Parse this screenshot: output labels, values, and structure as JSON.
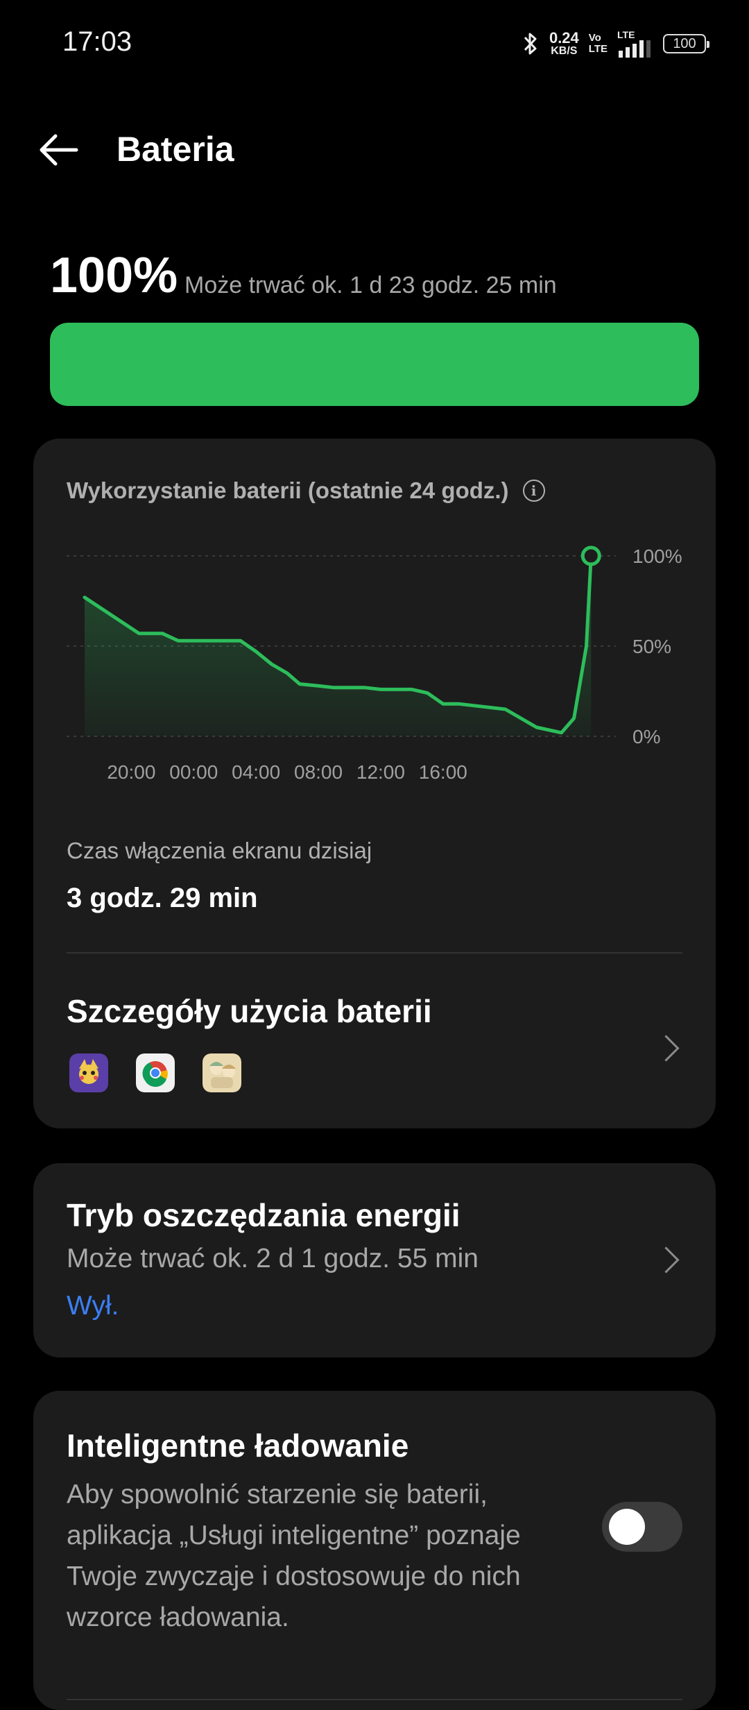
{
  "status_bar": {
    "time": "17:03",
    "net_speed_value": "0.24",
    "net_speed_unit": "KB/S",
    "volte_top": "Vo",
    "volte_bottom": "LTE",
    "signal_label": "LTE",
    "battery_level": "100",
    "icons": [
      "bluetooth-icon",
      "signal-icon",
      "battery-icon"
    ]
  },
  "header": {
    "title": "Bateria",
    "back_icon": "arrow-left-icon"
  },
  "summary": {
    "percent": "100%",
    "estimate": "Może trwać ok. 1 d 23 godz. 25 min",
    "level_fraction": 1.0,
    "bar_color": "#2dbd5b"
  },
  "usage_card": {
    "title": "Wykorzystanie baterii (ostatnie 24 godz.)",
    "info_icon": "info-icon",
    "screen_time_label": "Czas włączenia ekranu dzisiaj",
    "screen_time_value": "3 godz. 29 min",
    "details_title": "Szczegóły użycia baterii",
    "apps": [
      "pokemon-app-icon",
      "chrome-icon",
      "game-app-icon"
    ]
  },
  "chart_data": {
    "type": "area",
    "x_ticks": [
      "20:00",
      "00:00",
      "04:00",
      "08:00",
      "12:00",
      "16:00"
    ],
    "y_ticks": [
      "100%",
      "50%",
      "0%"
    ],
    "ylim": [
      0,
      100
    ],
    "grid": true,
    "line_color": "#2dbd5b",
    "hours_since_start": [
      0,
      3.5,
      5,
      6,
      8,
      10,
      11,
      12,
      13,
      13.8,
      15,
      16,
      17,
      18,
      19,
      21,
      22,
      23,
      24,
      25,
      27,
      28,
      29,
      30.6,
      31.4,
      32.2,
      32.5
    ],
    "x_start": "17:00",
    "values": [
      77,
      57,
      57,
      53,
      53,
      53,
      47,
      40,
      35,
      29,
      28,
      27,
      27,
      27,
      26,
      26,
      24,
      18,
      18,
      17,
      15,
      10,
      5,
      2,
      10,
      50,
      100
    ]
  },
  "power_saving": {
    "title": "Tryb oszczędzania energii",
    "subtitle": "Może trwać ok. 2 d 1 godz. 55 min",
    "state": "Wył."
  },
  "smart_charging": {
    "title": "Inteligentne ładowanie",
    "description": "Aby spowolnić starzenie się baterii, aplikacja „Usługi inteligentne” poznaje Twoje zwyczaje i dostosowuje do nich wzorce ładowania.",
    "enabled": false
  }
}
